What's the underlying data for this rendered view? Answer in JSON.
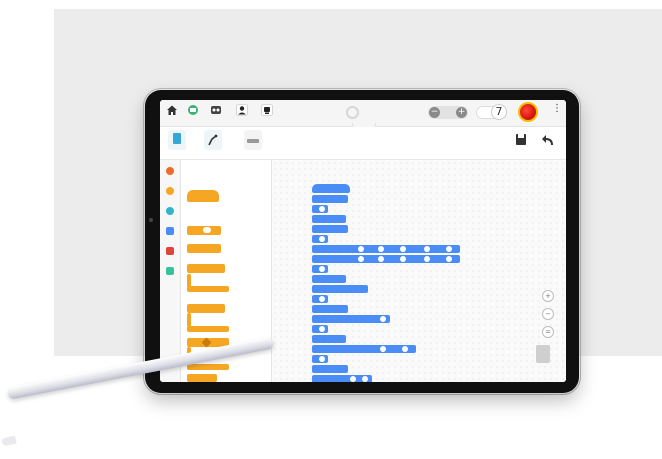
{
  "scene": {
    "description_color_backdrop": "#ececec",
    "device": "tablet",
    "accessory": "stylus-pen"
  },
  "app": {
    "topbar": {
      "icons": [
        "home-icon",
        "robot-icon",
        "connect-icon",
        "user-icon",
        "device-icon"
      ],
      "zoom_buttons": [
        "−",
        "+"
      ],
      "number_badge": "7",
      "estop": "emergency-stop-button"
    },
    "colors": {
      "block_orange": "#f5a623",
      "block_blue": "#4a8df6",
      "accent_red": "#d8140e"
    },
    "categories": [
      {
        "color": "#f06a2a"
      },
      {
        "color": "#f5a623"
      },
      {
        "color": "#2fb5c8"
      },
      {
        "color": "#4a8df6"
      },
      {
        "color": "#e0453a"
      },
      {
        "color": "#36c29a"
      }
    ]
  }
}
